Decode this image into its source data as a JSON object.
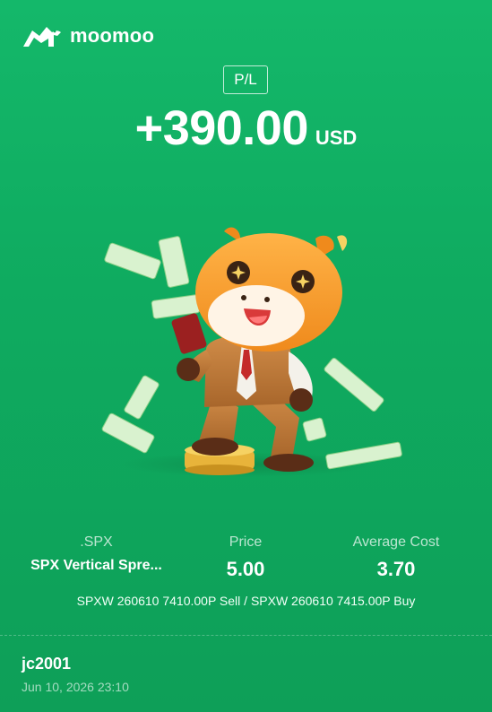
{
  "brand": {
    "name": "moomoo"
  },
  "header": {
    "tag": "P/L",
    "value": "+390.00",
    "currency": "USD"
  },
  "position": {
    "symbol_label": ".SPX",
    "symbol_name": "SPX Vertical Spre...",
    "price_label": "Price",
    "price_value": "5.00",
    "avg_cost_label": "Average Cost",
    "avg_cost_value": "3.70",
    "legs": "SPXW 260610 7410.00P Sell / SPXW 260610 7415.00P Buy"
  },
  "footer": {
    "username": "jc2001",
    "timestamp": "Jun 10, 2026 23:10"
  },
  "colors": {
    "background": "#10ad62",
    "text": "#ffffff",
    "mascot": "#f39a2b",
    "suit": "#c07a3a"
  },
  "icons": [
    "moomoo-bull-logo-icon",
    "bull-mascot-illustration",
    "banknote-icon",
    "gold-coin-stack-icon"
  ]
}
